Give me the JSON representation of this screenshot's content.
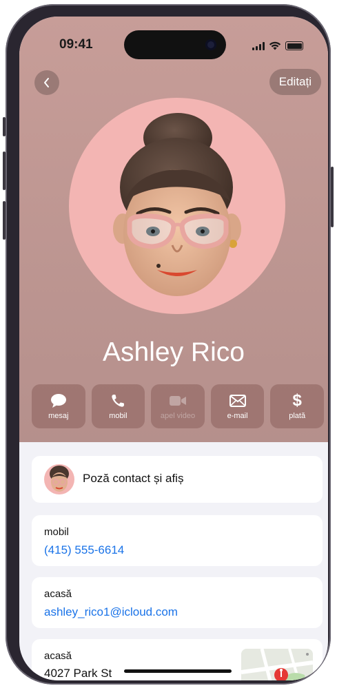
{
  "status": {
    "time": "09:41"
  },
  "nav": {
    "edit_label": "Editați"
  },
  "contact": {
    "name": "Ashley Rico"
  },
  "actions": [
    {
      "label": "mesaj",
      "icon": "message-bubble-icon",
      "enabled": true
    },
    {
      "label": "mobil",
      "icon": "phone-icon",
      "enabled": true
    },
    {
      "label": "apel video",
      "icon": "video-camera-icon",
      "enabled": false
    },
    {
      "label": "e-mail",
      "icon": "envelope-icon",
      "enabled": true
    },
    {
      "label": "plată",
      "icon": "dollar-icon",
      "enabled": true
    }
  ],
  "photo_poster": {
    "label": "Poză contact și afiș"
  },
  "phone_card": {
    "label": "mobil",
    "value": "(415) 555-6614"
  },
  "email_card": {
    "label": "acasă",
    "value": "ashley_rico1@icloud.com"
  },
  "address_card": {
    "label": "acasă",
    "value": "4027 Park St"
  },
  "colors": {
    "header": "#c79d98",
    "link": "#1a73e8",
    "avatar_bg": "#f3b5b3"
  }
}
